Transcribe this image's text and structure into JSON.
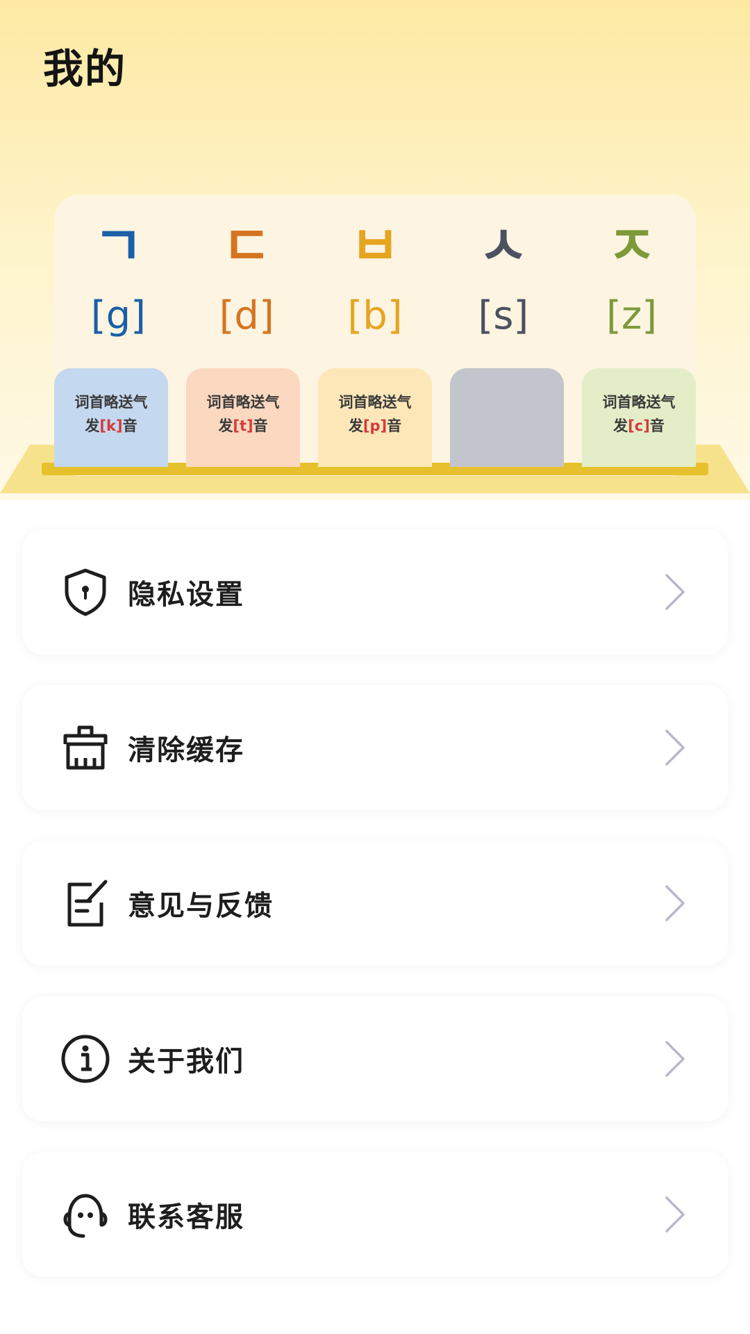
{
  "page": {
    "title": "我的"
  },
  "letters": [
    {
      "hangul": "ㄱ",
      "roman": "[g]",
      "color": "#1a5fa8"
    },
    {
      "hangul": "ㄷ",
      "roman": "[d]",
      "color": "#d6741f"
    },
    {
      "hangul": "ㅂ",
      "roman": "[b]",
      "color": "#e5a521"
    },
    {
      "hangul": "ㅅ",
      "roman": "[s]",
      "color": "#4b5160"
    },
    {
      "hangul": "ㅈ",
      "roman": "[z]",
      "color": "#7c9a3a"
    }
  ],
  "cards": [
    {
      "line1": "词首略送气",
      "prefix": "发",
      "sound": "[k]",
      "suffix": "音",
      "bg": "#c4d8ef"
    },
    {
      "line1": "词首略送气",
      "prefix": "发",
      "sound": "[t]",
      "suffix": "音",
      "bg": "#fbd8c0"
    },
    {
      "line1": "词首略送气",
      "prefix": "发",
      "sound": "[p]",
      "suffix": "音",
      "bg": "#fde7b8"
    },
    {
      "line1": "",
      "prefix": "",
      "sound": "",
      "suffix": "",
      "bg": "#c3c5cc"
    },
    {
      "line1": "词首略送气",
      "prefix": "发",
      "sound": "[c]",
      "suffix": "音",
      "bg": "#e3eec8"
    }
  ],
  "menu": {
    "items": [
      {
        "label": "隐私设置",
        "icon": "shield-lock-icon"
      },
      {
        "label": "清除缓存",
        "icon": "broom-icon"
      },
      {
        "label": "意见与反馈",
        "icon": "feedback-edit-icon"
      },
      {
        "label": "关于我们",
        "icon": "info-icon"
      },
      {
        "label": "联系客服",
        "icon": "customer-service-icon"
      }
    ]
  }
}
